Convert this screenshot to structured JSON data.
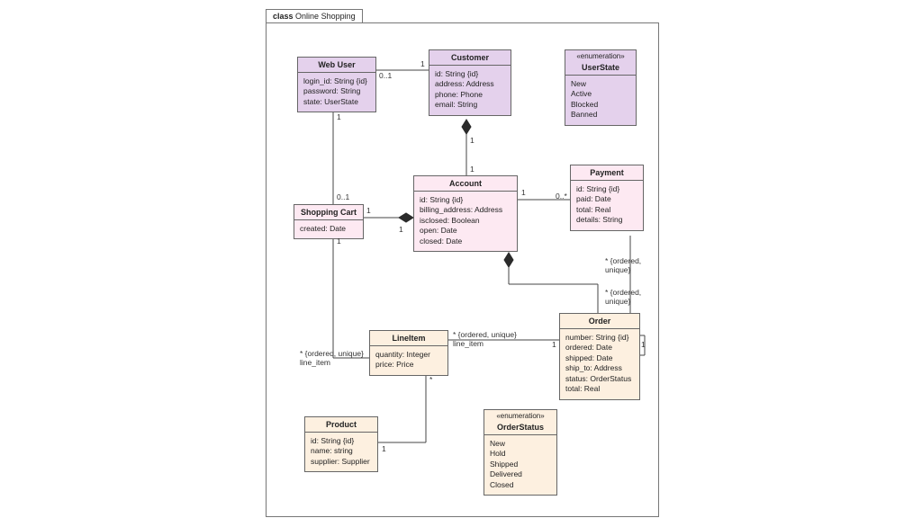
{
  "diagram_title_prefix": "class",
  "diagram_title": "Online Shopping",
  "web_user": {
    "name": "Web User",
    "attrs": [
      "login_id: String {id}",
      "password: String",
      "state: UserState"
    ]
  },
  "customer": {
    "name": "Customer",
    "attrs": [
      "id: String {id}",
      "address: Address",
      "phone: Phone",
      "email: String"
    ]
  },
  "user_state": {
    "stereo": "«enumeration»",
    "name": "UserState",
    "literals": [
      "New",
      "Active",
      "Blocked",
      "Banned"
    ]
  },
  "shopping_cart": {
    "name": "Shopping Cart",
    "attrs": [
      "created: Date"
    ]
  },
  "account": {
    "name": "Account",
    "attrs": [
      "id: String {id}",
      "billing_address: Address",
      "isclosed: Boolean",
      "open: Date",
      "closed: Date"
    ]
  },
  "payment": {
    "name": "Payment",
    "attrs": [
      "id: String {id}",
      "paid: Date",
      "total: Real",
      "details: String"
    ]
  },
  "line_item": {
    "name": "LineItem",
    "attrs": [
      "quantity: Integer",
      "price: Price"
    ]
  },
  "order": {
    "name": "Order",
    "attrs": [
      "number: String {id}",
      "ordered: Date",
      "shipped: Date",
      "ship_to: Address",
      "status: OrderStatus",
      "total: Real"
    ]
  },
  "product": {
    "name": "Product",
    "attrs": [
      "id: String {id}",
      "name: string",
      "supplier: Supplier"
    ]
  },
  "order_status": {
    "stereo": "«enumeration»",
    "name": "OrderStatus",
    "literals": [
      "New",
      "Hold",
      "Shipped",
      "Delivered",
      "Closed"
    ]
  },
  "mult": {
    "one": "1",
    "zero_one": "0..1",
    "zero_star": "0..*",
    "star": "*"
  },
  "lbl": {
    "line_item": "line_item",
    "ordered_unique": "* {ordered, unique}",
    "ordered_unique_two": "* {ordered,\nunique}"
  },
  "chart_data": {
    "type": "uml_class_diagram",
    "package": "Online Shopping",
    "classes": [
      {
        "name": "Web User",
        "kind": "class",
        "attributes": [
          "login_id: String {id}",
          "password: String",
          "state: UserState"
        ]
      },
      {
        "name": "Customer",
        "kind": "class",
        "attributes": [
          "id: String {id}",
          "address: Address",
          "phone: Phone",
          "email: String"
        ]
      },
      {
        "name": "UserState",
        "kind": "enumeration",
        "literals": [
          "New",
          "Active",
          "Blocked",
          "Banned"
        ]
      },
      {
        "name": "Shopping Cart",
        "kind": "class",
        "attributes": [
          "created: Date"
        ]
      },
      {
        "name": "Account",
        "kind": "class",
        "attributes": [
          "id: String {id}",
          "billing_address: Address",
          "isclosed: Boolean",
          "open: Date",
          "closed: Date"
        ]
      },
      {
        "name": "Payment",
        "kind": "class",
        "attributes": [
          "id: String {id}",
          "paid: Date",
          "total: Real",
          "details: String"
        ]
      },
      {
        "name": "LineItem",
        "kind": "class",
        "attributes": [
          "quantity: Integer",
          "price: Price"
        ]
      },
      {
        "name": "Order",
        "kind": "class",
        "attributes": [
          "number: String {id}",
          "ordered: Date",
          "shipped: Date",
          "ship_to: Address",
          "status: OrderStatus",
          "total: Real"
        ]
      },
      {
        "name": "Product",
        "kind": "class",
        "attributes": [
          "id: String {id}",
          "name: string",
          "supplier: Supplier"
        ]
      },
      {
        "name": "OrderStatus",
        "kind": "enumeration",
        "literals": [
          "New",
          "Hold",
          "Shipped",
          "Delivered",
          "Closed"
        ]
      }
    ],
    "relationships": [
      {
        "from": "Web User",
        "to": "Customer",
        "type": "association",
        "from_mult": "0..1",
        "to_mult": "1"
      },
      {
        "from": "Customer",
        "to": "Account",
        "type": "composition",
        "owner": "Customer",
        "from_mult": "1",
        "to_mult": "1"
      },
      {
        "from": "Web User",
        "to": "Shopping Cart",
        "type": "association",
        "from_mult": "1",
        "to_mult": "0..1"
      },
      {
        "from": "Account",
        "to": "Shopping Cart",
        "type": "composition",
        "owner": "Account",
        "from_mult": "1",
        "to_mult": "1"
      },
      {
        "from": "Account",
        "to": "Payment",
        "type": "association",
        "from_mult": "1",
        "to_mult": "0..*"
      },
      {
        "from": "Account",
        "to": "Order",
        "type": "composition",
        "owner": "Account",
        "from_mult": "1",
        "to_mult": "* {ordered, unique}"
      },
      {
        "from": "Shopping Cart",
        "to": "LineItem",
        "type": "association",
        "from_mult": "1",
        "to_mult": "* {ordered, unique}",
        "role_to": "line_item"
      },
      {
        "from": "Order",
        "to": "LineItem",
        "type": "association",
        "from_mult": "1",
        "to_mult": "* {ordered, unique}",
        "role_to": "line_item"
      },
      {
        "from": "Payment",
        "to": "Order",
        "type": "association",
        "from_mult": "* {ordered, unique}",
        "to_mult": "1"
      },
      {
        "from": "LineItem",
        "to": "Product",
        "type": "association",
        "from_mult": "*",
        "to_mult": "1"
      }
    ]
  }
}
